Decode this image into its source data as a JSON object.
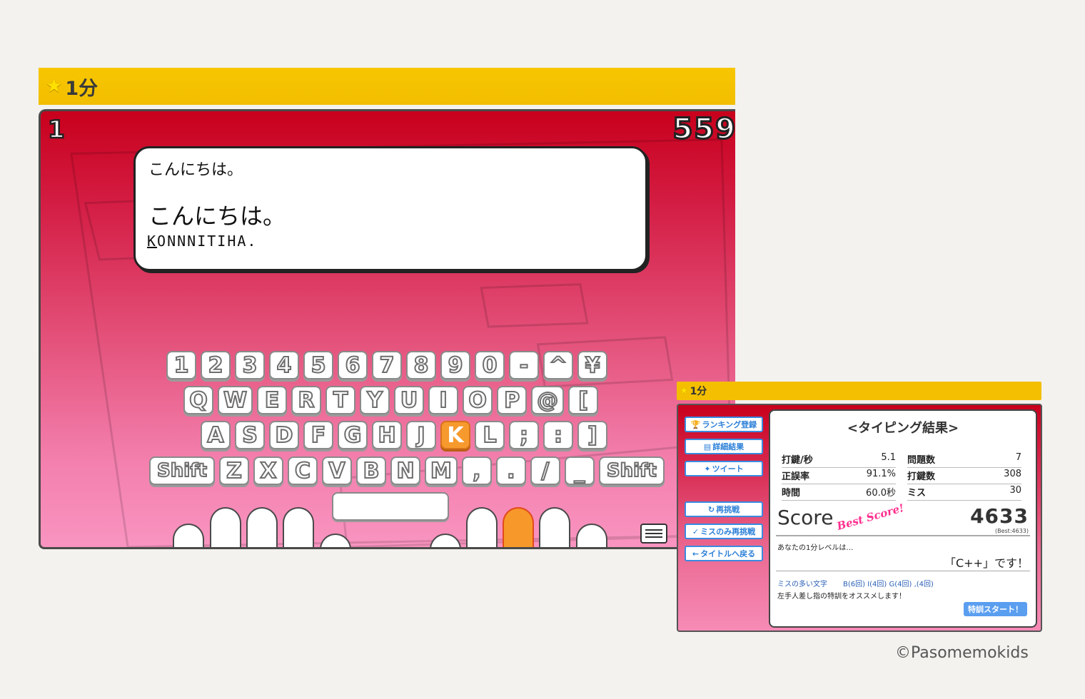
{
  "main": {
    "title": "1分",
    "question_number": "1",
    "score": "559",
    "prompt_small": "こんにちは。",
    "prompt_big": "こんにちは。",
    "romaji_current": "K",
    "romaji_rest": "ONNNITIHA.",
    "keyboard": {
      "row1": [
        "1",
        "2",
        "3",
        "4",
        "5",
        "6",
        "7",
        "8",
        "9",
        "0",
        "-",
        "^",
        "¥"
      ],
      "row2": [
        "Q",
        "W",
        "E",
        "R",
        "T",
        "Y",
        "U",
        "I",
        "O",
        "P",
        "@",
        "["
      ],
      "row3": [
        "A",
        "S",
        "D",
        "F",
        "G",
        "H",
        "J",
        "K",
        "L",
        ";",
        ":",
        "]"
      ],
      "row4": [
        "Shift",
        "Z",
        "X",
        "C",
        "V",
        "B",
        "N",
        "M",
        ",",
        ".",
        "/",
        "_",
        "Shift"
      ],
      "highlighted_key": "K"
    }
  },
  "result": {
    "title": "1分",
    "heading": "<タイピング結果>",
    "sidebar": {
      "ranking": "ランキング登録",
      "details": "詳細結果",
      "tweet": "ツイート",
      "retry": "再挑戦",
      "retry_miss": "ミスのみ再挑戦",
      "back_title": "タイトルへ戻る"
    },
    "stats": {
      "keys_per_sec_label": "打鍵/秒",
      "keys_per_sec": "5.1",
      "accuracy_label": "正誤率",
      "accuracy": "91.1%",
      "time_label": "時間",
      "time": "60.0秒",
      "questions_label": "問題数",
      "questions": "7",
      "keystrokes_label": "打鍵数",
      "keystrokes": "308",
      "miss_label": "ミス",
      "miss": "30"
    },
    "score_label": "Score",
    "best_score_stamp": "Best Score!",
    "score": "4633",
    "best": "(Best:4633)",
    "level_text": "あなたの1分レベルは…",
    "level_value": "「C++」です！",
    "miss_chars_label": "ミスの多い文字",
    "miss_chars": "B(6回)  I(4回)  G(4回)  ,(4回)",
    "advice": "左手人差し指の特訓をオススメします！",
    "train_button": "特訓スタート！"
  },
  "copyright": "©Pasomemokids",
  "colors": {
    "accent_yellow": "#f4bf00",
    "stage_red": "#c8001c",
    "highlight_orange": "#f79a2e",
    "button_blue": "#3a8be0"
  }
}
